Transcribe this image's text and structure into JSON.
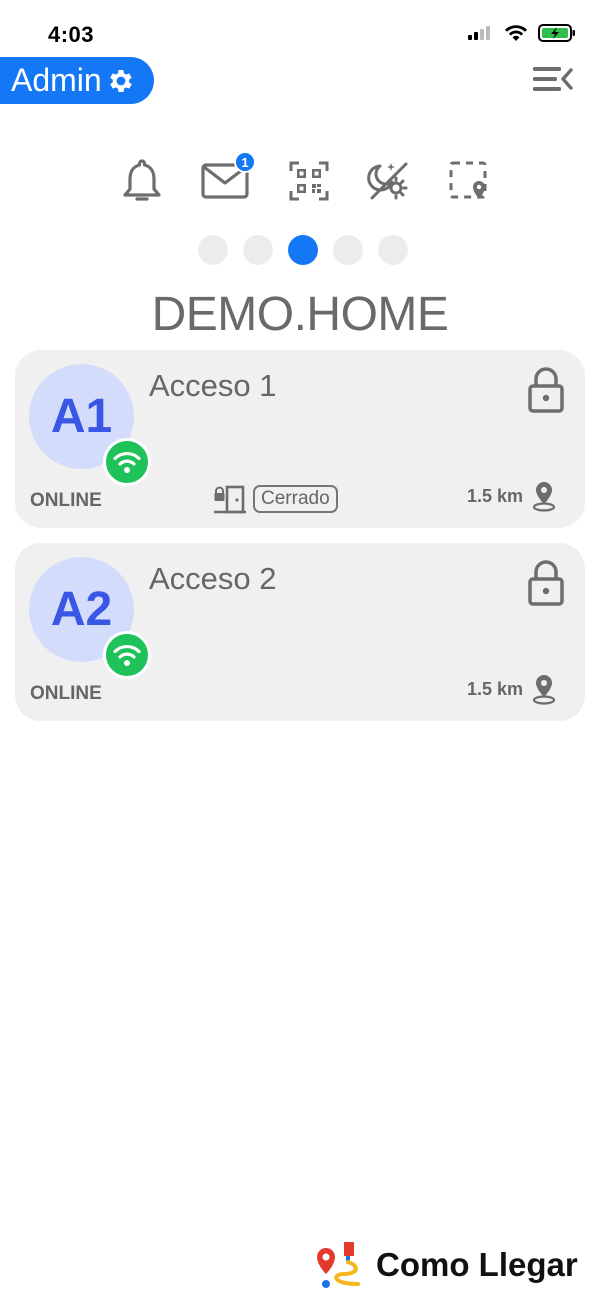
{
  "status_bar": {
    "time": "4:03"
  },
  "header": {
    "admin_label": "Admin"
  },
  "toolbar": {
    "mail_badge": "1"
  },
  "site_title": "DEMO.HOME",
  "accesses": [
    {
      "initials": "A1",
      "name": "Acceso 1",
      "status": "ONLINE",
      "door_state": "Cerrado",
      "distance": "1.5 km"
    },
    {
      "initials": "A2",
      "name": "Acceso 2",
      "status": "ONLINE",
      "distance": "1.5 km"
    }
  ],
  "footer": {
    "brand": "Como Llegar"
  },
  "colors": {
    "accent": "#1477f5",
    "online_green": "#1fc159",
    "avatar_bg": "#d4dcfb",
    "avatar_text": "#3a56e4",
    "card_bg": "#f0f0f0"
  }
}
